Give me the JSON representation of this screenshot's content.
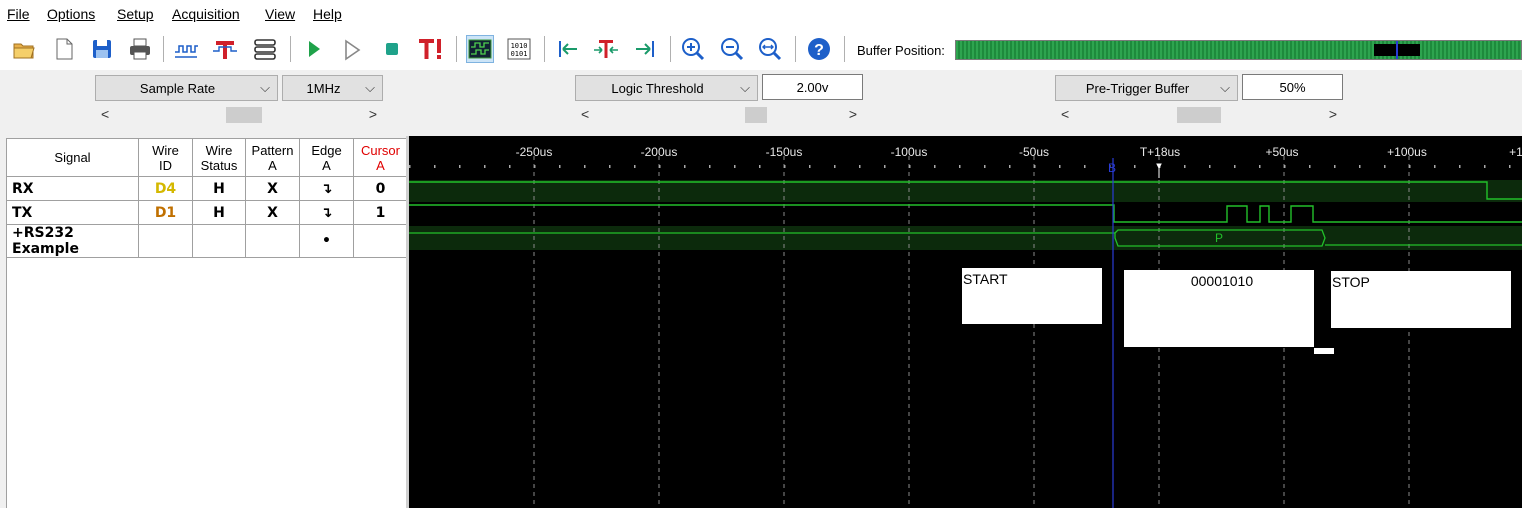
{
  "menu": [
    {
      "label": "File"
    },
    {
      "label": "Options"
    },
    {
      "label": "Setup"
    },
    {
      "label": "Acquisition"
    },
    {
      "label": "View"
    },
    {
      "label": "Help"
    }
  ],
  "toolbar": {
    "buffer_label": "Buffer Position:",
    "buffer_position": 0.82
  },
  "settings": {
    "sample_rate_label": "Sample Rate",
    "sample_rate_value": "1MHz",
    "logic_threshold_label": "Logic Threshold",
    "logic_threshold_value": "2.00v",
    "pretrigger_label": "Pre-Trigger Buffer",
    "pretrigger_value": "50%",
    "scroll_left": "<",
    "scroll_right": ">"
  },
  "table": {
    "headers": {
      "signal": "Signal",
      "wire_id": [
        "Wire",
        "ID"
      ],
      "wire_status": [
        "Wire",
        "Status"
      ],
      "pattern": [
        "Pattern",
        "A"
      ],
      "edge": [
        "Edge",
        "A"
      ],
      "cursor": [
        "Cursor",
        "A"
      ]
    },
    "rows": [
      {
        "name": "RX",
        "wire_id": "D4",
        "status": "H",
        "pattern": "X",
        "edge": "↴",
        "cursor": "0"
      },
      {
        "name": "TX",
        "wire_id": "D1",
        "status": "H",
        "pattern": "X",
        "edge": "↴",
        "cursor": "1"
      },
      {
        "name": "+RS232 Example",
        "wire_id": "",
        "status": "",
        "pattern": "",
        "edge": "•",
        "cursor": ""
      }
    ]
  },
  "timeline": {
    "ticks": [
      "-250us",
      "-200us",
      "-150us",
      "-100us",
      "-50us",
      "T+18us",
      "+50us",
      "+100us",
      "+1"
    ],
    "cursor_marker": "B",
    "bus_label": "P"
  },
  "annotations": {
    "start": "START",
    "data": "00001010",
    "stop": "STOP"
  },
  "colors": {
    "wire_d4": "#d4b800",
    "wire_d1": "#c07000",
    "cursor_header": "#e00000",
    "trace": "#22c02a",
    "cursor_line": "#2a3bd6"
  }
}
